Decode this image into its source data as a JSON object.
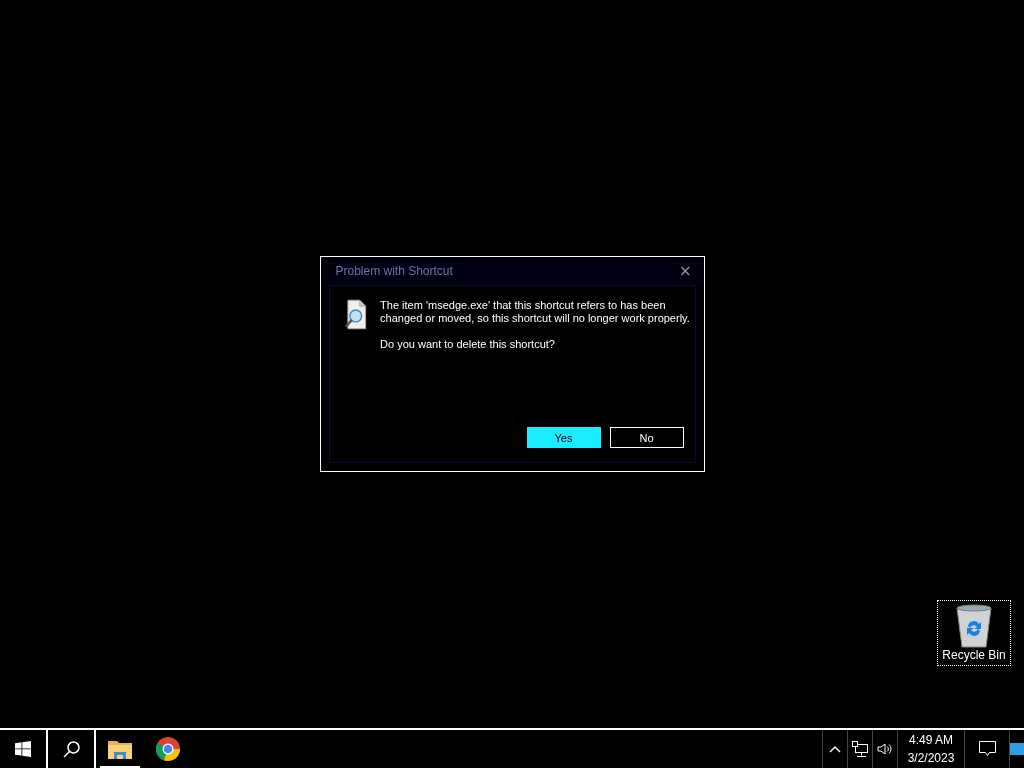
{
  "dialog": {
    "title": "Problem with Shortcut",
    "close": "×",
    "message": "The item 'msedge.exe' that this shortcut refers to has been changed or moved, so this shortcut will no longer work properly.",
    "question": "Do you want to delete this shortcut?",
    "buttons": [
      {
        "label": "Yes",
        "selected": true
      },
      {
        "label": "No",
        "selected": false
      }
    ]
  },
  "desktop_icons": [
    {
      "label": "Recycle Bin",
      "selected": true
    }
  ],
  "taskbar": {
    "apps": [
      {
        "kind": "folder",
        "active": true
      },
      {
        "kind": "browser",
        "active": false
      }
    ],
    "clock": {
      "time": "4:49 AM",
      "date": "3/2/2023"
    }
  }
}
